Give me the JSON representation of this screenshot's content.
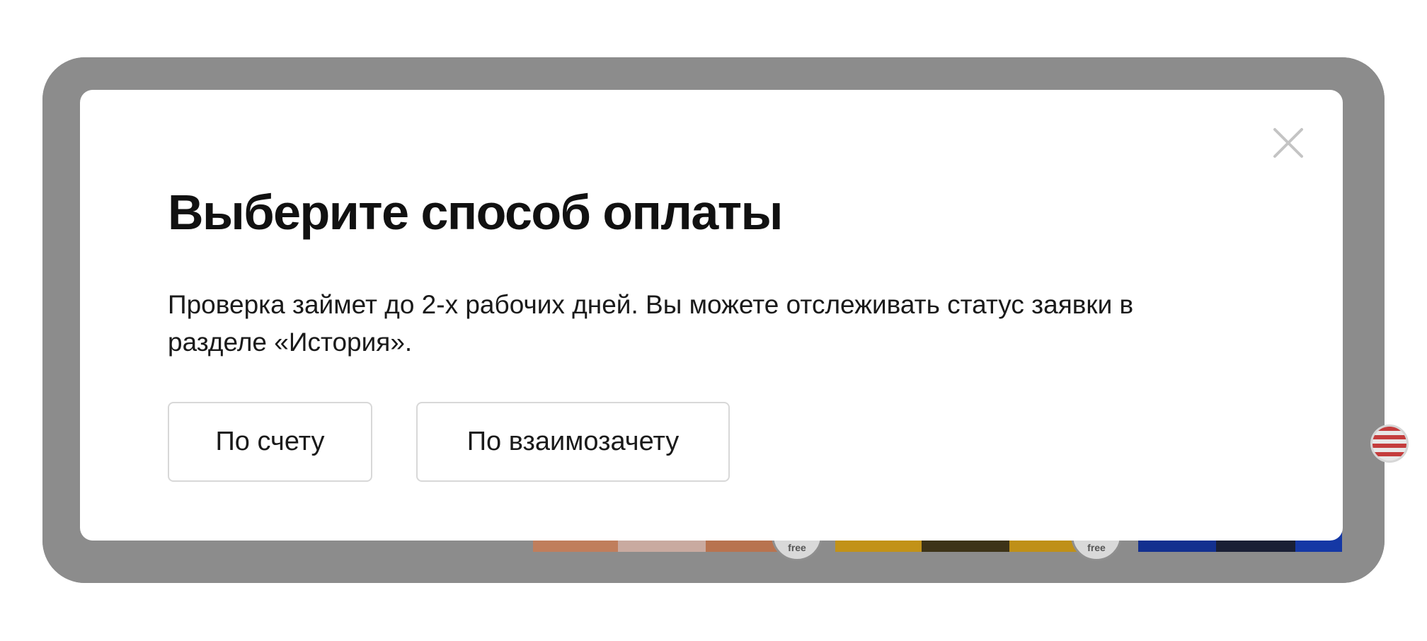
{
  "modal": {
    "title": "Выберите способ оплаты",
    "description": "Проверка займет до 2-х рабочих дней. Вы можете отслеживать статус заявки в разделе «История».",
    "close_icon": "close-icon",
    "buttons": [
      {
        "label": "По счету"
      },
      {
        "label": "По взаимозачету"
      }
    ]
  },
  "background": {
    "badge_text": "free",
    "overlay_color": "#8a8a8a"
  },
  "colors": {
    "title": "#111111",
    "button_border": "#d8d8d8",
    "close_icon": "#c4c4c4"
  }
}
